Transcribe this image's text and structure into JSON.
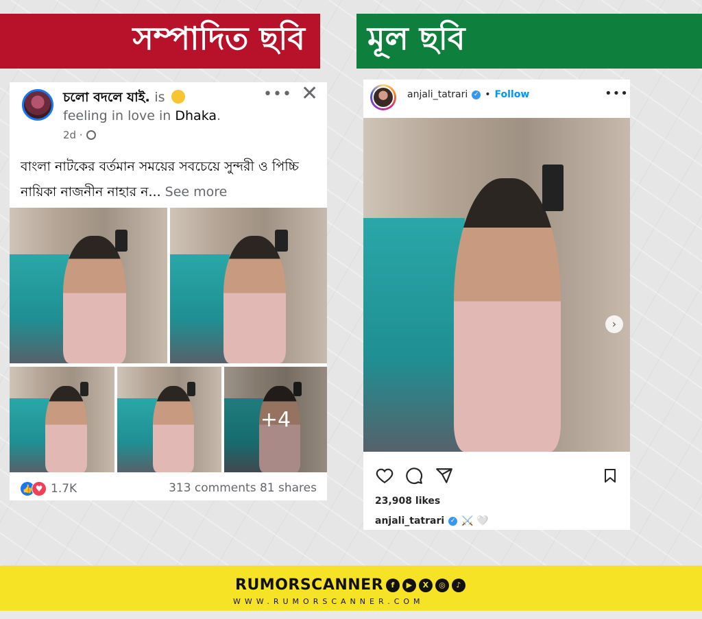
{
  "banners": {
    "left": "সম্পাদিত ছবি",
    "right": "মূল ছবি",
    "left_color": "#b8122b",
    "right_color": "#0e7f3d"
  },
  "facebook_post": {
    "page_name": "চলো বদলে যাই.",
    "is_text": "is",
    "feeling_text": "feeling in love in",
    "location": "Dhaka",
    "location_suffix": ".",
    "time": "2d ·",
    "body": "বাংলা নাটকের বর্তমান সময়ের সবচেয়ে সুন্দরী ও পিচ্চি নায়িকা নাজনীন নাহার ন...",
    "see_more": "See more",
    "more_photos": "+4",
    "reaction_count": "1.7K",
    "comments": "313 comments",
    "shares": "81 shares",
    "icons": [
      "globe-icon",
      "more-icon",
      "close-icon",
      "like-reaction-icon",
      "love-reaction-icon"
    ]
  },
  "instagram_post": {
    "username": "anjali_tatrari",
    "follow": "Follow",
    "separator": "•",
    "likes": "23,908 likes",
    "caption_user": "anjali_tatrari",
    "caption_text": "⚔️ 🤍",
    "accent": "#0095f6",
    "icons": [
      "heart-icon",
      "comment-icon",
      "share-icon",
      "bookmark-icon",
      "more-icon",
      "verified-icon",
      "next-arrow-icon"
    ]
  },
  "footer": {
    "brand": "RUMORSCANNER",
    "url": "WWW.RUMORSCANNER.COM",
    "background": "#f6e326",
    "social_icons": [
      "f",
      "▶",
      "X",
      "◎",
      "♪"
    ]
  }
}
